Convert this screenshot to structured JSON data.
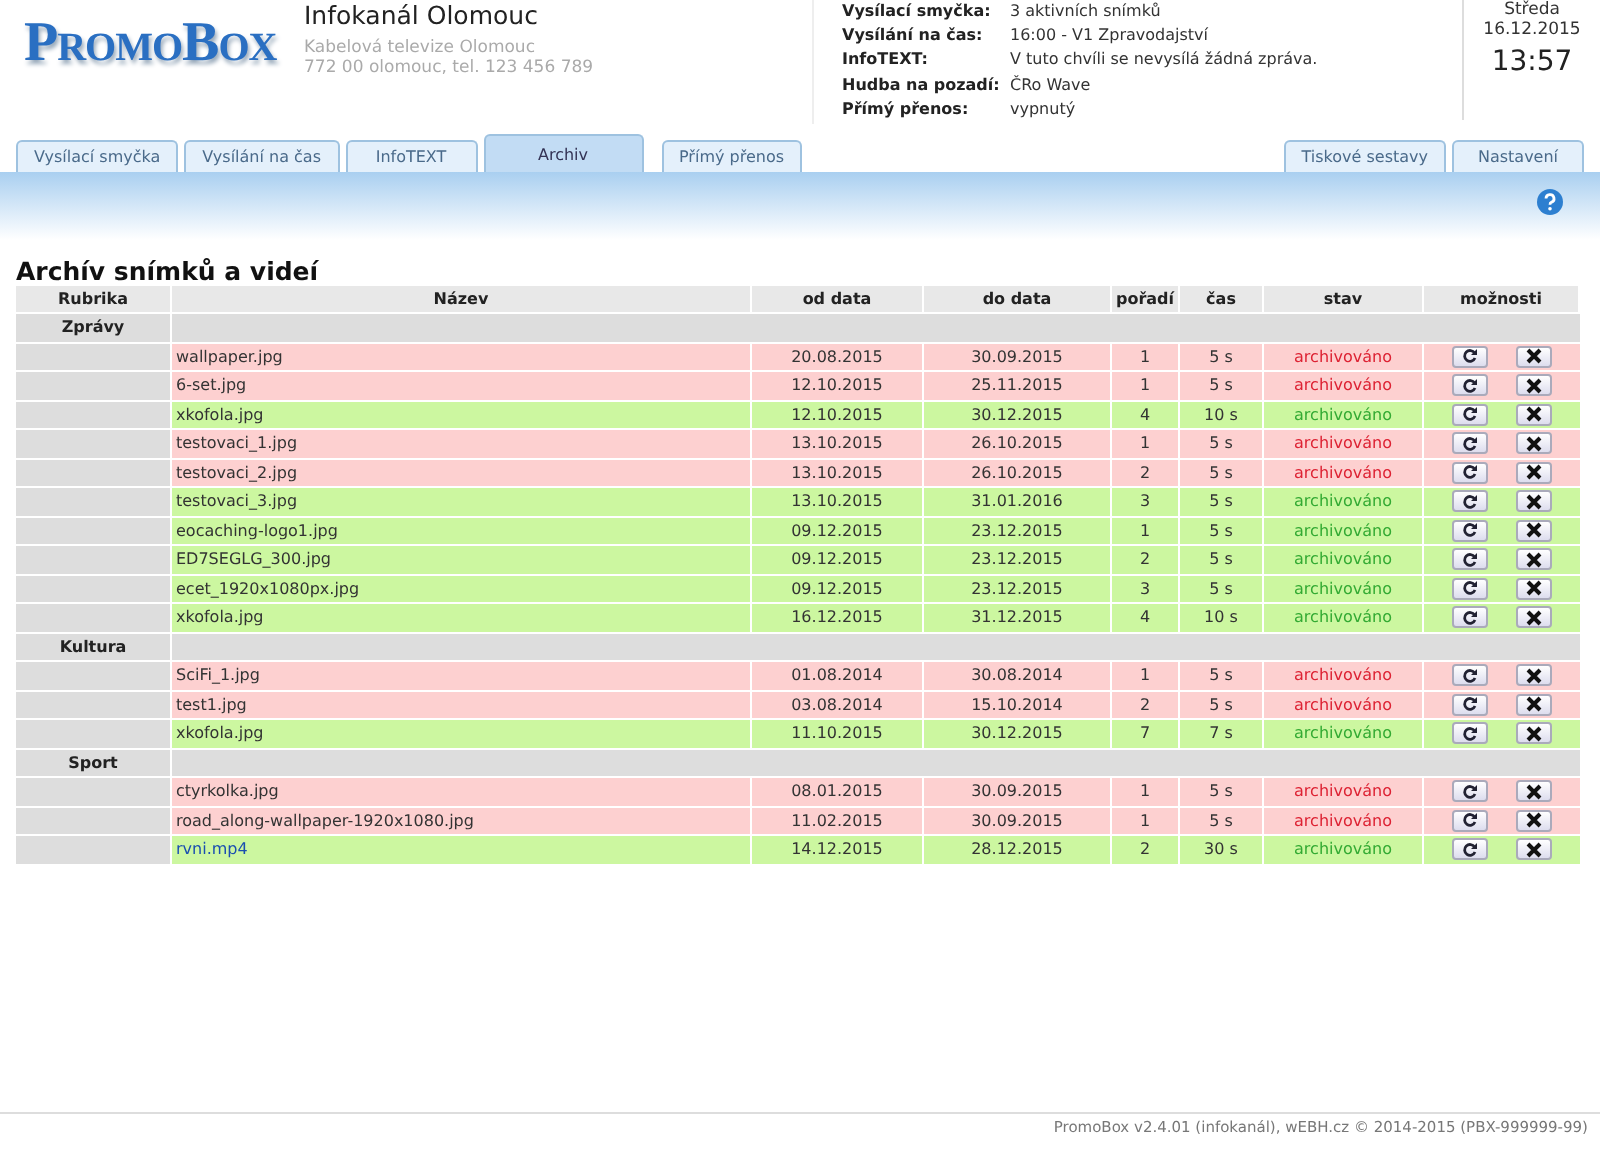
{
  "header": {
    "logo": "PromoBox",
    "title": "Infokanál Olomouc",
    "subtitle": "Kabelová televize Olomouc",
    "address": "772 00 olomouc, tel. 123 456 789"
  },
  "status": [
    {
      "label": "Vysílací smyčka:",
      "value": "3 aktivních snímků"
    },
    {
      "label": "Vysílání na čas:",
      "value": "16:00 - V1 Zpravodajství"
    },
    {
      "label": "InfoTEXT:",
      "value": "V tuto chvíli se nevysílá žádná zpráva."
    },
    {
      "label": "Hudba na pozadí:",
      "value": "ČRo Wave"
    },
    {
      "label": "Přímý přenos:",
      "value": "vypnutý"
    }
  ],
  "clock": {
    "day": "Středa",
    "date": "16.12.2015",
    "time": "13:57"
  },
  "tabs": [
    {
      "label": "Vysílací smyčka",
      "selected": false
    },
    {
      "label": "Vysílání na čas",
      "selected": false
    },
    {
      "label": "InfoTEXT",
      "selected": false
    },
    {
      "label": "Archiv",
      "selected": true
    },
    {
      "label": "Přímý přenos",
      "selected": false
    }
  ],
  "right_tabs": [
    {
      "label": "Tiskové sestavy",
      "selected": false
    },
    {
      "label": "Nastavení",
      "selected": false
    }
  ],
  "heading": "Archív snímků a videí",
  "table": {
    "columns": [
      "Rubrika",
      "Název",
      "od data",
      "do data",
      "pořadí",
      "čas",
      "stav",
      "možnosti"
    ],
    "groups": [
      {
        "name": "Zprávy",
        "rows": [
          {
            "kind": "expired",
            "link": false,
            "name": "wallpaper.jpg",
            "from": "20.08.2015",
            "to": "30.09.2015",
            "order": "1",
            "time": "5 s",
            "state": "archivováno"
          },
          {
            "kind": "expired",
            "link": false,
            "name": "6-set.jpg",
            "from": "12.10.2015",
            "to": "25.11.2015",
            "order": "1",
            "time": "5 s",
            "state": "archivováno"
          },
          {
            "kind": "active",
            "link": false,
            "name": "xkofola.jpg",
            "from": "12.10.2015",
            "to": "30.12.2015",
            "order": "4",
            "time": "10 s",
            "state": "archivováno"
          },
          {
            "kind": "expired",
            "link": false,
            "name": "testovaci_1.jpg",
            "from": "13.10.2015",
            "to": "26.10.2015",
            "order": "1",
            "time": "5 s",
            "state": "archivováno"
          },
          {
            "kind": "expired",
            "link": false,
            "name": "testovaci_2.jpg",
            "from": "13.10.2015",
            "to": "26.10.2015",
            "order": "2",
            "time": "5 s",
            "state": "archivováno"
          },
          {
            "kind": "active",
            "link": false,
            "name": "testovaci_3.jpg",
            "from": "13.10.2015",
            "to": "31.01.2016",
            "order": "3",
            "time": "5 s",
            "state": "archivováno"
          },
          {
            "kind": "active",
            "link": false,
            "name": "eocaching-logo1.jpg",
            "from": "09.12.2015",
            "to": "23.12.2015",
            "order": "1",
            "time": "5 s",
            "state": "archivováno"
          },
          {
            "kind": "active",
            "link": false,
            "name": "ED7SEGLG_300.jpg",
            "from": "09.12.2015",
            "to": "23.12.2015",
            "order": "2",
            "time": "5 s",
            "state": "archivováno"
          },
          {
            "kind": "active",
            "link": false,
            "name": "ecet_1920x1080px.jpg",
            "from": "09.12.2015",
            "to": "23.12.2015",
            "order": "3",
            "time": "5 s",
            "state": "archivováno"
          },
          {
            "kind": "active",
            "link": false,
            "name": "xkofola.jpg",
            "from": "16.12.2015",
            "to": "31.12.2015",
            "order": "4",
            "time": "10 s",
            "state": "archivováno"
          }
        ]
      },
      {
        "name": "Kultura",
        "rows": [
          {
            "kind": "expired",
            "link": false,
            "name": "SciFi_1.jpg",
            "from": "01.08.2014",
            "to": "30.08.2014",
            "order": "1",
            "time": "5 s",
            "state": "archivováno"
          },
          {
            "kind": "expired",
            "link": false,
            "name": "test1.jpg",
            "from": "03.08.2014",
            "to": "15.10.2014",
            "order": "2",
            "time": "5 s",
            "state": "archivováno"
          },
          {
            "kind": "active",
            "link": false,
            "name": "xkofola.jpg",
            "from": "11.10.2015",
            "to": "30.12.2015",
            "order": "7",
            "time": "7 s",
            "state": "archivováno"
          }
        ]
      },
      {
        "name": "Sport",
        "rows": [
          {
            "kind": "expired",
            "link": false,
            "name": "ctyrkolka.jpg",
            "from": "08.01.2015",
            "to": "30.09.2015",
            "order": "1",
            "time": "5 s",
            "state": "archivováno"
          },
          {
            "kind": "expired",
            "link": false,
            "name": "road_along-wallpaper-1920x1080.jpg",
            "from": "11.02.2015",
            "to": "30.09.2015",
            "order": "1",
            "time": "5 s",
            "state": "archivováno"
          },
          {
            "kind": "active",
            "link": true,
            "name": "rvni.mp4",
            "from": "14.12.2015",
            "to": "28.12.2015",
            "order": "2",
            "time": "30 s",
            "state": "archivováno"
          }
        ]
      }
    ]
  },
  "footer": "PromoBox v2.4.01 (infokanál), wEBH.cz © 2014-2015 (PBX-999999-99)"
}
